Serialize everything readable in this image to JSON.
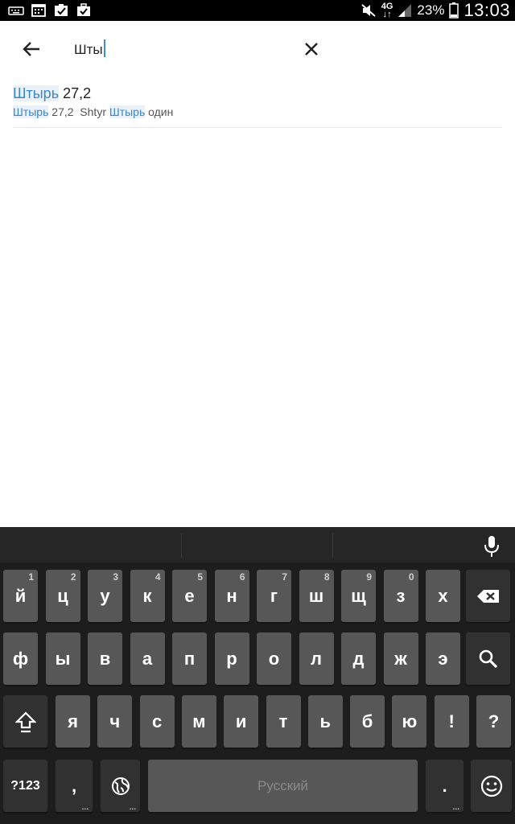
{
  "status_bar": {
    "network": "4G",
    "battery": "23%",
    "time": "13:03",
    "icons": [
      "keyboard-icon",
      "calendar-icon",
      "clipboard-check-icon",
      "briefcase-check-icon",
      "mute-icon",
      "signal-icon",
      "battery-icon"
    ]
  },
  "search": {
    "query": "Шты"
  },
  "results": [
    {
      "title_match": "Штырь",
      "title_rest": " 27,2",
      "sub_match1": "Штырь",
      "sub_mid": " 27,2  Shtyr ",
      "sub_match2": "Штырь",
      "sub_rest": " один"
    }
  ],
  "keyboard": {
    "row1": [
      {
        "label": "й",
        "hint": "1"
      },
      {
        "label": "ц",
        "hint": "2"
      },
      {
        "label": "у",
        "hint": "3"
      },
      {
        "label": "к",
        "hint": "4"
      },
      {
        "label": "е",
        "hint": "5"
      },
      {
        "label": "н",
        "hint": "6"
      },
      {
        "label": "г",
        "hint": "7"
      },
      {
        "label": "ш",
        "hint": "8"
      },
      {
        "label": "щ",
        "hint": "9"
      },
      {
        "label": "з",
        "hint": "0"
      },
      {
        "label": "х",
        "hint": ""
      }
    ],
    "row2": [
      "ф",
      "ы",
      "в",
      "а",
      "п",
      "р",
      "о",
      "л",
      "д",
      "ж",
      "э"
    ],
    "row3": [
      "я",
      "ч",
      "с",
      "м",
      "и",
      "т",
      "ь",
      "б",
      "ю",
      "!",
      "?"
    ],
    "symbols_label": "?123",
    "comma": ",",
    "space_label": "Русский",
    "period": "."
  }
}
